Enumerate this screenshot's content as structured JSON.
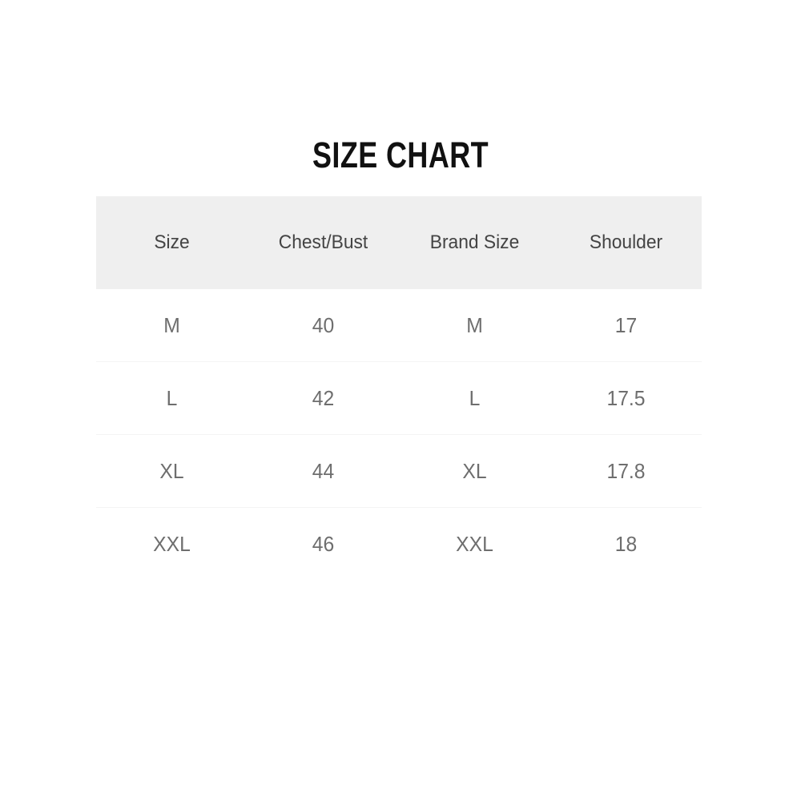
{
  "title": "SIZE CHART",
  "table": {
    "columns": [
      "Size",
      "Chest/Bust",
      "Brand Size",
      "Shoulder"
    ],
    "rows": [
      [
        "M",
        "40",
        "M",
        "17"
      ],
      [
        "L",
        "42",
        "L",
        "17.5"
      ],
      [
        "XL",
        "44",
        "XL",
        "17.8"
      ],
      [
        "XXL",
        "46",
        "XXL",
        "18"
      ]
    ]
  },
  "colors": {
    "page_background": "#ffffff",
    "header_background": "#efefef",
    "title_text": "#111111",
    "header_text": "#444444",
    "cell_text": "#6e6e6e",
    "row_divider": "#f4f4f4"
  },
  "chart_data": {
    "type": "table",
    "title": "SIZE CHART",
    "columns": [
      "Size",
      "Chest/Bust",
      "Brand Size",
      "Shoulder"
    ],
    "rows": [
      {
        "Size": "M",
        "Chest/Bust": "40",
        "Brand Size": "M",
        "Shoulder": "17"
      },
      {
        "Size": "L",
        "Chest/Bust": "42",
        "Brand Size": "L",
        "Shoulder": "17.5"
      },
      {
        "Size": "XL",
        "Chest/Bust": "44",
        "Brand Size": "XL",
        "Shoulder": "17.8"
      },
      {
        "Size": "XXL",
        "Chest/Bust": "46",
        "Brand Size": "XXL",
        "Shoulder": "18"
      }
    ],
    "xlabel": "",
    "ylabel": "",
    "grid": false,
    "legend": "none"
  }
}
